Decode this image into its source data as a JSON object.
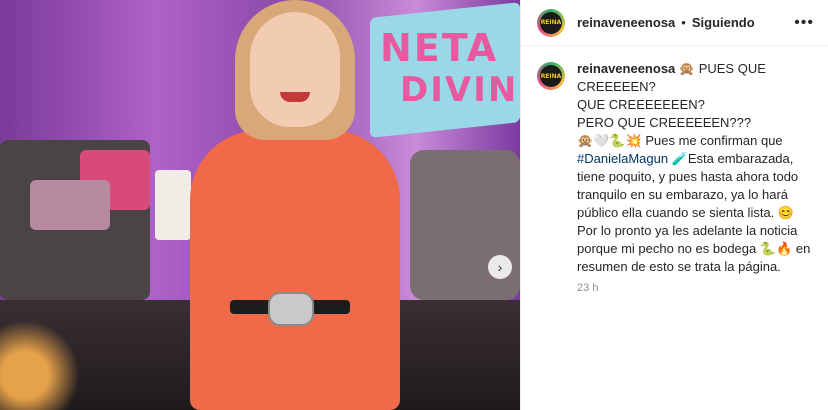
{
  "header": {
    "username": "reinaveneenosa",
    "separator": "•",
    "follow_label": "Siguiendo",
    "more_icon": "more-horizontal-icon",
    "avatar_text": "REINA"
  },
  "media": {
    "sign_line1": "NETA",
    "sign_line2": "DIVIN",
    "next_glyph": "›"
  },
  "caption": {
    "username": "reinaveneenosa",
    "part1": " 🙊 PUES QUE CREEEEEN?\nQUE CREEEEEEEN?\nPERO QUE CREEEEEEN???\n🙊🤍🐍💥 Pues me confirman que\n",
    "hashtag": "#DanielaMagun",
    "part2": " 🧪Esta embarazada, tiene poquito, y pues hasta ahora todo tranquilo en su embarazo, ya lo hará público ella cuando se sienta lista. 😊 Por lo pronto ya les adelante la noticia porque mi pecho no es bodega 🐍🔥 en resumen de esto se trata la página.",
    "time": "23 h"
  }
}
